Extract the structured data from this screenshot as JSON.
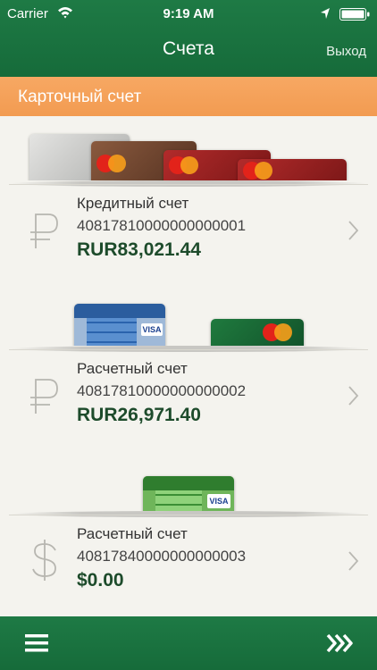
{
  "status_bar": {
    "carrier": "Carrier",
    "time": "9:19 AM"
  },
  "nav": {
    "title": "Счета",
    "logout_label": "Выход"
  },
  "section": {
    "title": "Карточный счет"
  },
  "accounts": [
    {
      "name": "Кредитный счет",
      "number": "40817810000000000001",
      "balance": "RUR83,021.44",
      "currency_icon": "ruble-icon"
    },
    {
      "name": "Расчетный счет",
      "number": "40817810000000000002",
      "balance": "RUR26,971.40",
      "currency_icon": "ruble-icon"
    },
    {
      "name": "Расчетный счет",
      "number": "40817840000000000003",
      "balance": "$0.00",
      "currency_icon": "dollar-icon"
    }
  ],
  "colors": {
    "brand_green": "#166b3a",
    "section_orange": "#f29b51",
    "balance_green": "#1d4b2b",
    "background": "#f4f3ee"
  }
}
